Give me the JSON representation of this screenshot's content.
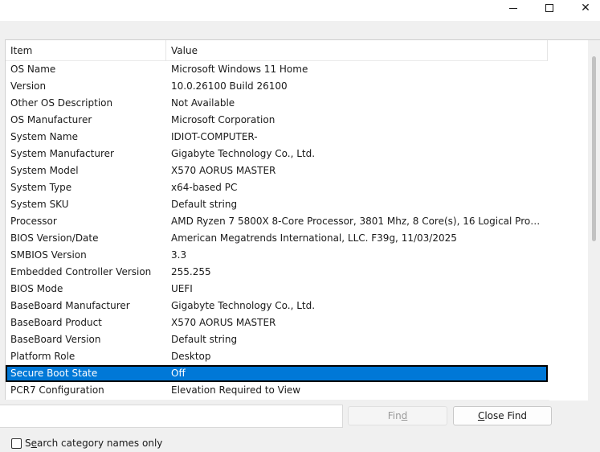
{
  "window": {
    "minimize_glyph": "minimize-icon",
    "maximize_glyph": "maximize-icon",
    "close_glyph": "✕"
  },
  "table": {
    "columns": [
      "Item",
      "Value"
    ],
    "rows": [
      {
        "item": "OS Name",
        "value": "Microsoft Windows 11 Home"
      },
      {
        "item": "Version",
        "value": "10.0.26100 Build 26100"
      },
      {
        "item": "Other OS Description",
        "value": "Not Available"
      },
      {
        "item": "OS Manufacturer",
        "value": "Microsoft Corporation"
      },
      {
        "item": "System Name",
        "value": "IDIOT-COMPUTER-"
      },
      {
        "item": "System Manufacturer",
        "value": "Gigabyte Technology Co., Ltd."
      },
      {
        "item": "System Model",
        "value": "X570 AORUS MASTER"
      },
      {
        "item": "System Type",
        "value": "x64-based PC"
      },
      {
        "item": "System SKU",
        "value": "Default string"
      },
      {
        "item": "Processor",
        "value": "AMD Ryzen 7 5800X 8-Core Processor, 3801 Mhz, 8 Core(s), 16 Logical Proce..."
      },
      {
        "item": "BIOS Version/Date",
        "value": "American Megatrends International, LLC. F39g, 11/03/2025"
      },
      {
        "item": "SMBIOS Version",
        "value": "3.3"
      },
      {
        "item": "Embedded Controller Version",
        "value": "255.255"
      },
      {
        "item": "BIOS Mode",
        "value": "UEFI"
      },
      {
        "item": "BaseBoard Manufacturer",
        "value": "Gigabyte Technology Co., Ltd."
      },
      {
        "item": "BaseBoard Product",
        "value": "X570 AORUS MASTER"
      },
      {
        "item": "BaseBoard Version",
        "value": "Default string"
      },
      {
        "item": "Platform Role",
        "value": "Desktop"
      },
      {
        "item": "Secure Boot State",
        "value": "Off"
      },
      {
        "item": "PCR7 Configuration",
        "value": "Elevation Required to View"
      }
    ],
    "selected_row": 18
  },
  "find": {
    "input_value": "",
    "find_button_pre": "Fin",
    "find_button_ul": "d",
    "close_find_pre": "",
    "close_find_ul": "C",
    "close_find_post": "lose Find",
    "search_category_pre": "S",
    "search_category_ul": "e",
    "search_category_post": "arch category names only",
    "search_category_checked": false
  },
  "colors": {
    "selection": "#0078d7",
    "background": "#f0f0f0"
  }
}
